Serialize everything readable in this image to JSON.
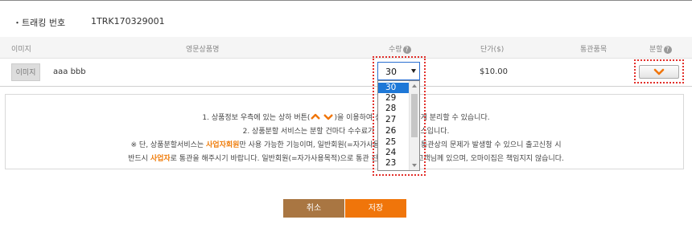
{
  "tracking": {
    "label": "・트래킹 번호",
    "value": "1TRK170329001"
  },
  "table": {
    "headers": {
      "image": "이미지",
      "product_name": "영문상품명",
      "qty": "수량",
      "unit_price": "단가($)",
      "customs": "통관품목",
      "split": "분할"
    },
    "help_glyph": "?",
    "row": {
      "image_label": "이미지",
      "product_name": "aaa bbb",
      "qty": "30",
      "price": "$10.00"
    }
  },
  "qty_dropdown": {
    "selected": "30",
    "options": [
      "30",
      "29",
      "28",
      "27",
      "26",
      "25",
      "24",
      "23"
    ]
  },
  "notice": {
    "line1_a": "1. 상품정보 우측에 있는 상하 버튼(",
    "line1_b": ")을 이용하여 상",
    "line1_c": "하게 분리할 수 있습니다.",
    "line2_a": "2. 상품분할 서비스는 분할 건마다 수수료가 ",
    "line2_b": "비스입니다.",
    "line3_a": "※ 단, 상품분할서비스는 ",
    "line3_hl": "사업자회원",
    "line3_b": "만 사용 가능한 기능이며, 일반회원(=자가사용",
    "line3_c": "우 통관상의 문제가 발생할 수 있으니 출고신청 시",
    "line4_a": "반드시 ",
    "line4_hl": "사업자",
    "line4_b": "로 통관을 해주시기 바랍니다. 일반회원(=자가사용목적)으로 통관 진행",
    "line4_c": "고객님께 있으며, 오마이집은 책임지지 않습니다."
  },
  "buttons": {
    "cancel": "취소",
    "save": "저장"
  },
  "colors": {
    "accent": "#f0750a",
    "cancel": "#a97642",
    "highlight": "#ef7d0c",
    "dropdown_selected": "#1e78d7",
    "annotation_outline": "#e2302b"
  }
}
